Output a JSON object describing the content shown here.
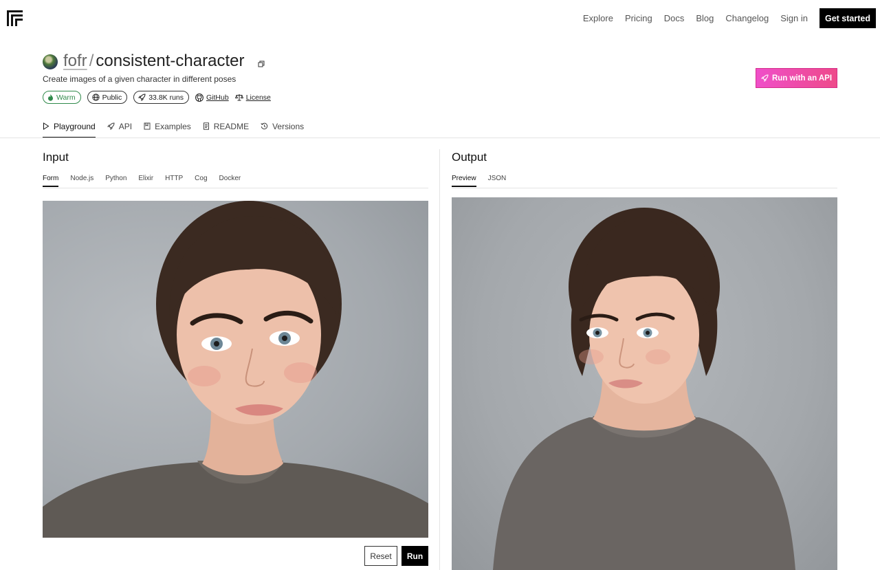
{
  "nav": {
    "links": [
      "Explore",
      "Pricing",
      "Docs",
      "Blog",
      "Changelog",
      "Sign in"
    ],
    "cta": "Get started"
  },
  "model": {
    "owner": "fofr",
    "separator": "/",
    "name": "consistent-character",
    "description": "Create images of a given character in different poses"
  },
  "badges": {
    "status": "Warm",
    "visibility": "Public",
    "runs": "33.8K runs",
    "github": "GitHub",
    "license": "License"
  },
  "api_button": "Run with an API",
  "tabs": [
    "Playground",
    "API",
    "Examples",
    "README",
    "Versions"
  ],
  "input": {
    "title": "Input",
    "tabs": [
      "Form",
      "Node.js",
      "Python",
      "Elixir",
      "HTTP",
      "Cog",
      "Docker"
    ],
    "reset_label": "Reset",
    "run_label": "Run"
  },
  "output": {
    "title": "Output",
    "tabs": [
      "Preview",
      "JSON"
    ]
  },
  "colors": {
    "accent_pink": "#ea2bbe",
    "warm_green": "#2f8a4a"
  }
}
